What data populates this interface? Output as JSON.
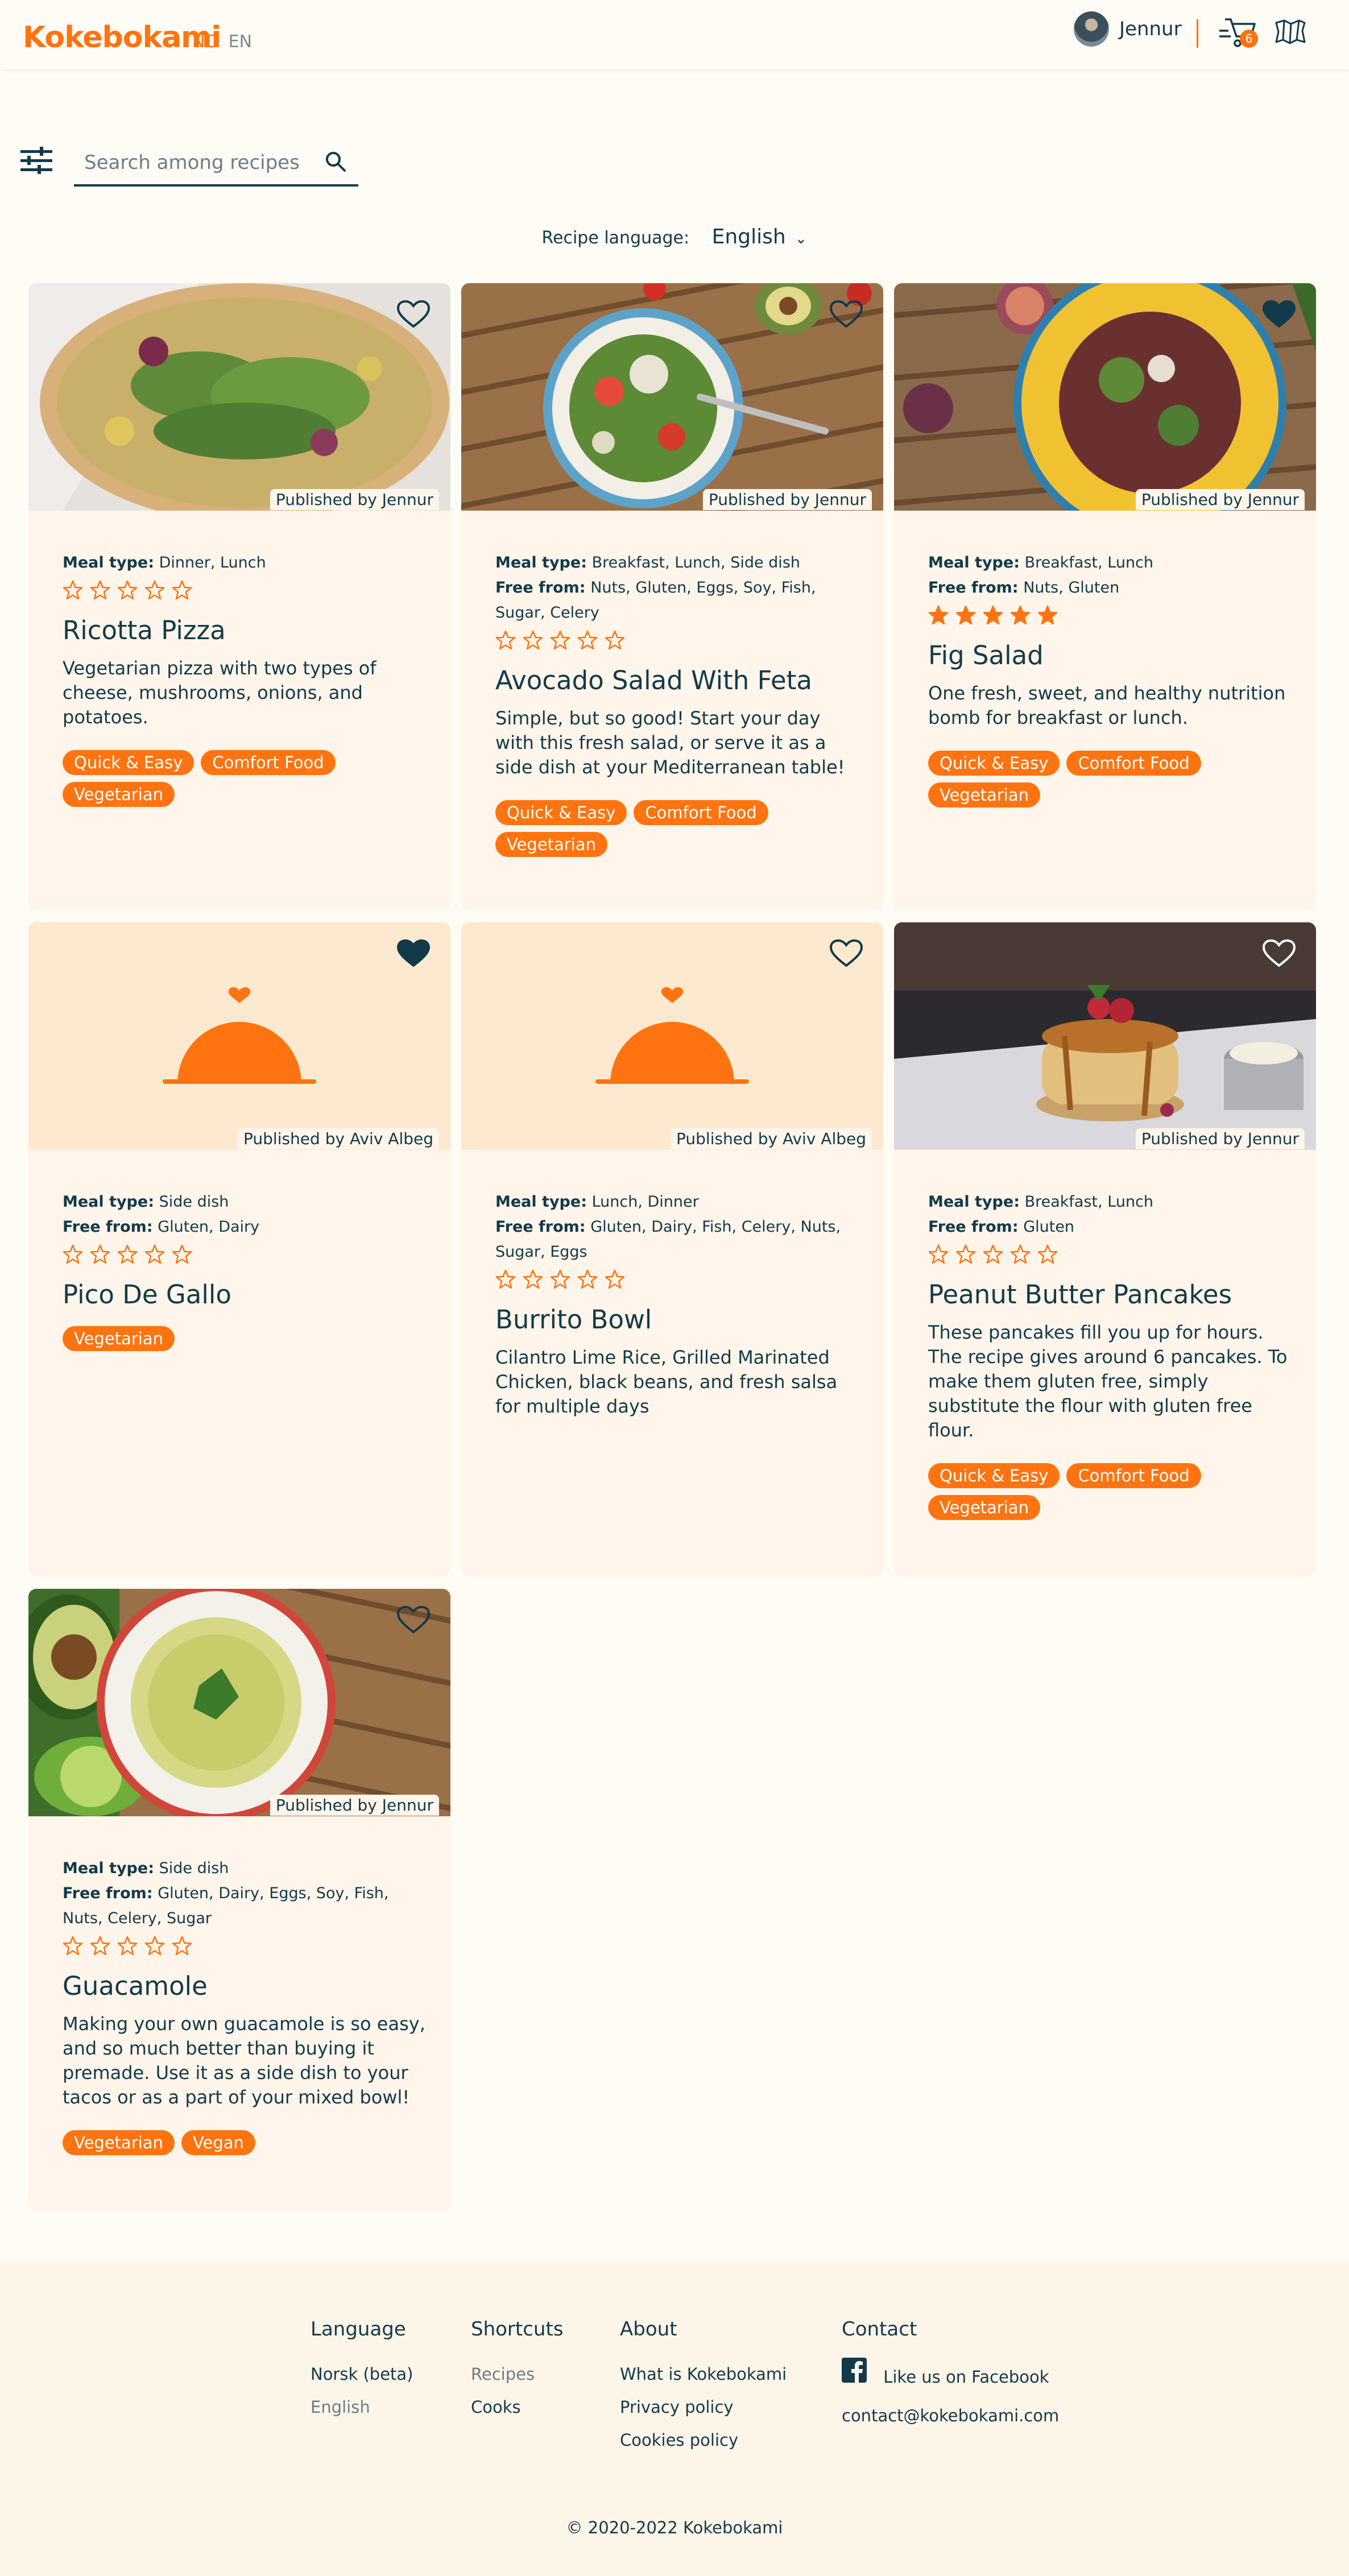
{
  "header": {
    "logo": "Kokebokami",
    "lang_no": "NO",
    "lang_en": "EN",
    "username": "Jennur",
    "basket_count": "6"
  },
  "search": {
    "placeholder": "Search among recipes"
  },
  "recipe_language": {
    "label": "Recipe language:",
    "value": "English"
  },
  "labels": {
    "meal_type": "Meal type:",
    "free_from": "Free from:"
  },
  "cards": [
    {
      "published": "Published by Jennur",
      "meal_type": "Dinner, Lunch",
      "free_from": "",
      "rating": 0,
      "title": "Ricotta Pizza",
      "desc": "Vegetarian pizza with two types of cheese, mushrooms, onions, and potatoes.",
      "tags": [
        "Quick & Easy",
        "Comfort Food",
        "Vegetarian"
      ],
      "favorite": false
    },
    {
      "published": "Published by Jennur",
      "meal_type": "Breakfast, Lunch, Side dish",
      "free_from": "Nuts, Gluten, Eggs, Soy, Fish, Sugar, Celery",
      "rating": 0,
      "title": "Avocado Salad With Feta",
      "desc": "Simple, but so good! Start your day with this fresh salad, or serve it as a side dish at your Mediterranean table!",
      "tags": [
        "Quick & Easy",
        "Comfort Food",
        "Vegetarian"
      ],
      "favorite": false
    },
    {
      "published": "Published by Jennur",
      "meal_type": "Breakfast, Lunch",
      "free_from": "Nuts, Gluten",
      "rating": 5,
      "title": "Fig Salad",
      "desc": "One fresh, sweet, and healthy nutrition bomb for breakfast or lunch.",
      "tags": [
        "Quick & Easy",
        "Comfort Food",
        "Vegetarian"
      ],
      "favorite": true
    },
    {
      "published": "Published by Aviv Albeg",
      "meal_type": "Side dish",
      "free_from": "Gluten, Dairy",
      "rating": 0,
      "title": "Pico De Gallo",
      "desc": "",
      "tags": [
        "Vegetarian"
      ],
      "favorite": true
    },
    {
      "published": "Published by Aviv Albeg",
      "meal_type": "Lunch, Dinner",
      "free_from": "Gluten, Dairy, Fish, Celery, Nuts, Sugar, Eggs",
      "rating": 0,
      "title": "Burrito Bowl",
      "desc": "Cilantro Lime Rice, Grilled Marinated Chicken, black beans, and fresh salsa for multiple days",
      "tags": [],
      "favorite": false
    },
    {
      "published": "Published by Jennur",
      "meal_type": "Breakfast, Lunch",
      "free_from": "Gluten",
      "rating": 0,
      "title": "Peanut Butter Pancakes",
      "desc": "These pancakes fill you up for hours. The recipe gives around 6 pancakes. To make them gluten free, simply substitute the flour with gluten free flour.",
      "tags": [
        "Quick & Easy",
        "Comfort Food",
        "Vegetarian"
      ],
      "favorite": false
    },
    {
      "published": "Published by Jennur",
      "meal_type": "Side dish",
      "free_from": "Gluten, Dairy, Eggs, Soy, Fish, Nuts, Celery, Sugar",
      "rating": 0,
      "title": "Guacamole",
      "desc": "Making your own guacamole is so easy, and so much better than buying it premade. Use it as a side dish to your tacos or as a part of your mixed bowl!",
      "tags": [
        "Vegetarian",
        "Vegan"
      ],
      "favorite": false
    }
  ],
  "footer": {
    "language": {
      "heading": "Language",
      "items": [
        "Norsk (beta)",
        "English"
      ]
    },
    "shortcuts": {
      "heading": "Shortcuts",
      "items": [
        "Recipes",
        "Cooks"
      ]
    },
    "about": {
      "heading": "About",
      "items": [
        "What is Kokebokami",
        "Privacy policy",
        "Cookies policy"
      ]
    },
    "contact": {
      "heading": "Contact",
      "facebook": "Like us on Facebook",
      "email": "contact@kokebokami.com"
    },
    "copyright": "© 2020-2022 Kokebokami"
  },
  "colors": {
    "accent": "#ff7410",
    "text": "#123a4a",
    "card": "#fff5ea",
    "background": "#fffbf5"
  }
}
